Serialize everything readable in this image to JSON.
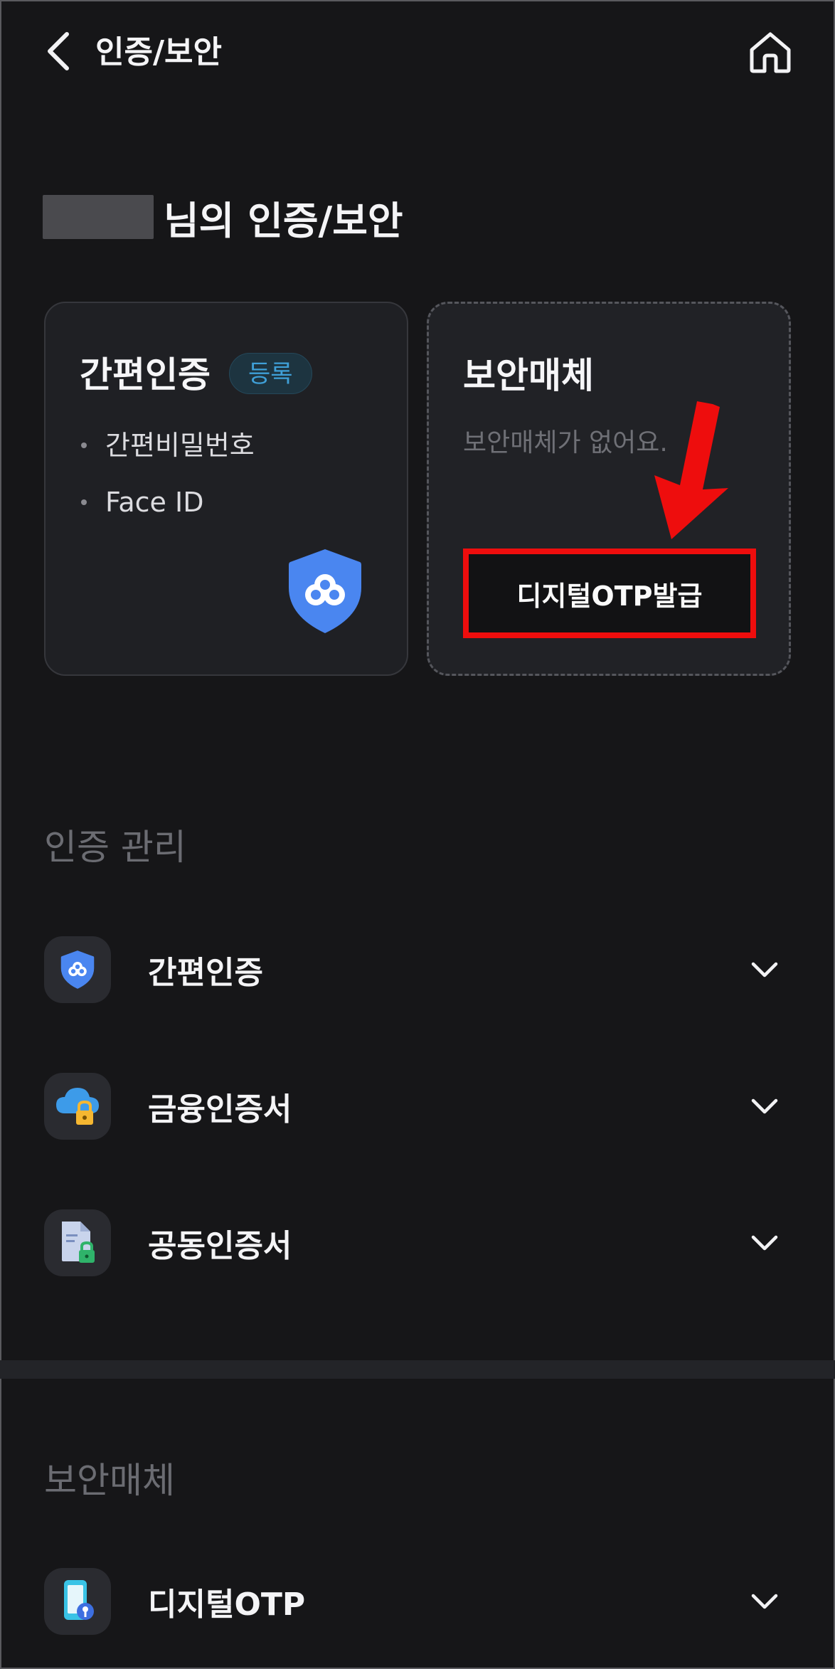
{
  "header": {
    "title": "인증/보안",
    "back_icon": "chevron-left-icon",
    "home_icon": "home-icon"
  },
  "greeting": {
    "suffix": "님의 인증/보안"
  },
  "auth_card": {
    "title": "간편인증",
    "badge": "등록",
    "items": [
      "간편비밀번호",
      "Face ID"
    ],
    "icon": "shield-cloud-icon"
  },
  "media_card": {
    "title": "보안매체",
    "empty_text": "보안매체가 없어요.",
    "button_label": "디지털OTP발급"
  },
  "auth_section": {
    "title": "인증 관리",
    "rows": [
      {
        "label": "간편인증",
        "icon": "shield-cloud-icon"
      },
      {
        "label": "금융인증서",
        "icon": "cloud-lock-icon"
      },
      {
        "label": "공동인증서",
        "icon": "document-lock-icon"
      }
    ]
  },
  "media_section": {
    "title": "보안매체",
    "rows": [
      {
        "label": "디지털OTP",
        "icon": "phone-key-icon"
      }
    ]
  },
  "colors": {
    "background": "#161618",
    "card": "#1f2024",
    "badge_text": "#3fa0d8",
    "highlight": "#ee0d0d",
    "shield_blue": "#4a86f0"
  }
}
